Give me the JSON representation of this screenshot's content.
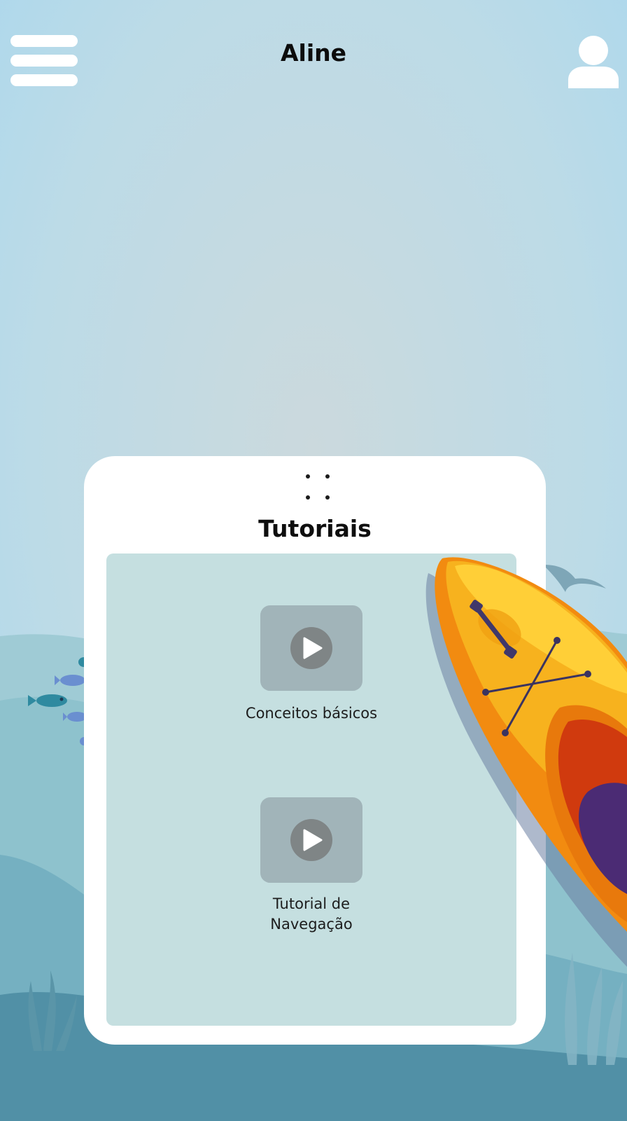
{
  "header": {
    "title": "Aline",
    "menu_icon": "hamburger-menu-icon",
    "profile_icon": "user-profile-icon"
  },
  "card": {
    "title": "Tutoriais",
    "handle_icon": "drag-handle-icon",
    "items": [
      {
        "label": "Conceitos básicos",
        "icon": "play-icon"
      },
      {
        "label": "Tutorial de Navegação",
        "icon": "play-icon"
      }
    ]
  },
  "colors": {
    "sky_top": "#acd8ee",
    "sky_bottom": "#c8dbe0",
    "card_background": "#ffffff",
    "panel_background": "#c5dfe0",
    "thumbnail": "#a1b4b9",
    "play_button": "#7f8586",
    "water_dark": "#5190a6",
    "kayak_yellow": "#f7b21e",
    "kayak_orange": "#f28b10"
  }
}
